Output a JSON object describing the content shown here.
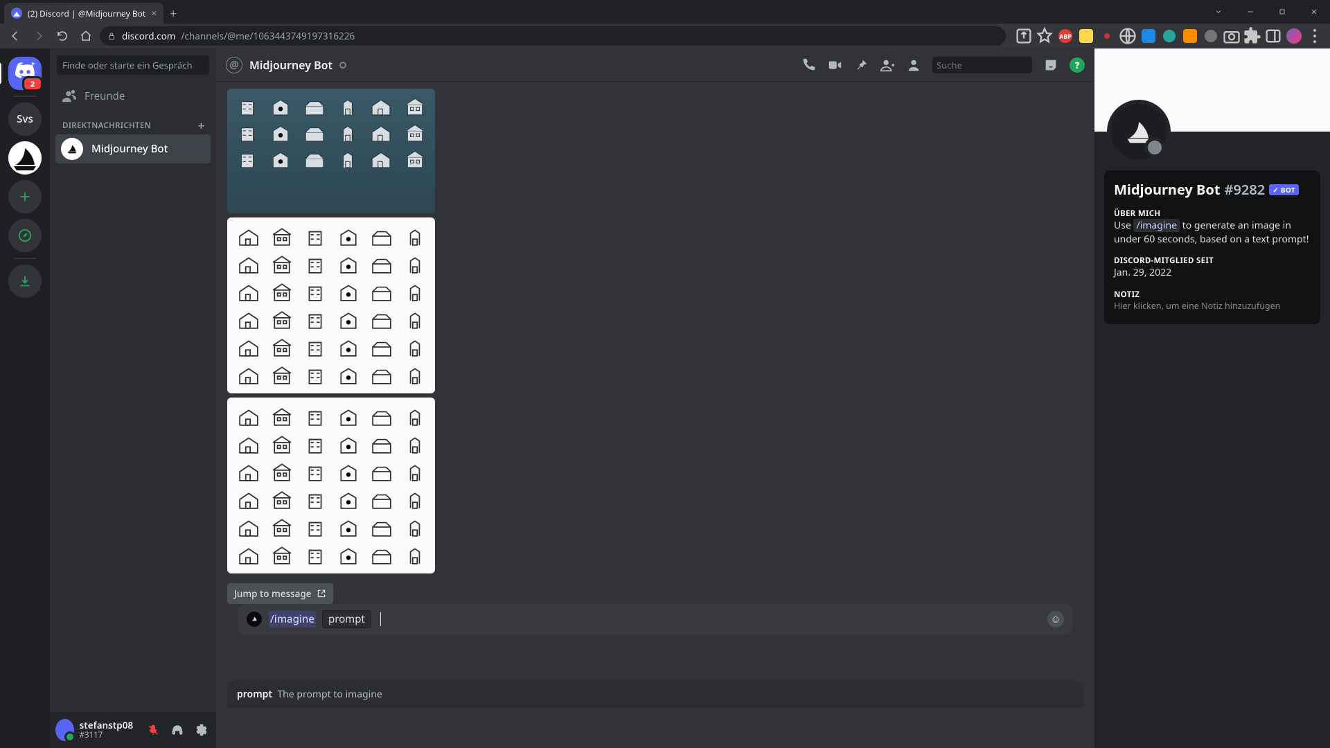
{
  "browser": {
    "tab_title": "(2) Discord | @Midjourney Bot",
    "url_host": "discord.com",
    "url_path": "/channels/@me/1063443749197316226"
  },
  "guild_rail": {
    "home_badge": "2",
    "server_label": "Svs"
  },
  "dm_sidebar": {
    "search_placeholder": "Finde oder starte ein Gespräch",
    "friends_label": "Freunde",
    "section_label": "DIREKTNACHRICHTEN",
    "items": [
      {
        "name": "Midjourney Bot"
      }
    ]
  },
  "user_panel": {
    "username": "stefanstp08",
    "discriminator": "#3117"
  },
  "header": {
    "title": "Midjourney Bot",
    "search_placeholder": "Suche"
  },
  "messages": {
    "jump_label": "Jump to message"
  },
  "composer": {
    "hint_name": "prompt",
    "hint_desc": "The prompt to imagine",
    "command_text": "/imagine",
    "param_text": "prompt"
  },
  "profile": {
    "name": "Midjourney Bot",
    "discriminator": "#9282",
    "bot_badge": "BOT",
    "about_title": "ÜBER MICH",
    "about_pre": "Use ",
    "about_cmd": "/imagine",
    "about_post": " to generate an image in under 60 seconds, based on a text prompt!",
    "member_since_title": "DISCORD-MITGLIED SEIT",
    "member_since": "Jan. 29, 2022",
    "note_title": "NOTIZ",
    "note_placeholder": "Hier klicken, um eine Notiz hinzuzufügen"
  }
}
